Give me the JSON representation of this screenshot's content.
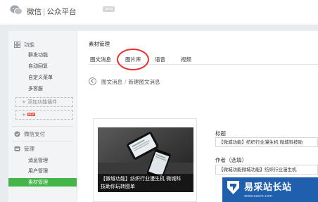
{
  "header": {
    "brand_left": "微信",
    "brand_sep": "|",
    "brand_right": "公众平台",
    "badge": "beta"
  },
  "sidebar": {
    "groups": [
      {
        "label": "功能",
        "icon": "function-icon"
      },
      {
        "label": "微信支付",
        "icon": "wechat-pay-icon"
      },
      {
        "label": "管理",
        "icon": "manage-icon"
      }
    ],
    "function_items": [
      "群发功能",
      "自动回复",
      "自定义菜单",
      "多客服"
    ],
    "add_plugin_label": "+ 添加功能插件",
    "add_plugin2_label": "+",
    "add_plugin2_badge": "NEW",
    "manage_items": [
      "消息管理",
      "用户管理",
      "素材管理"
    ]
  },
  "main": {
    "title": "素材管理",
    "tabs": [
      "图文消息",
      "图片库",
      "语音",
      "视频"
    ],
    "breadcrumb": {
      "parent": "图文消息",
      "separator": "/",
      "current": "新建图文消息"
    },
    "preview": {
      "caption_line1": "【微城功能】纺织行业漫生机 微城科",
      "caption_line2": "技助你玩转图单"
    },
    "form": {
      "title_label": "标题",
      "title_value": "【微城功能】纺织行业漫生机 微城科技助",
      "author_label": "作者（选填）",
      "author_value": "【微城功能微城功能】纺织行业漫生机"
    }
  },
  "watermark": {
    "name": "易采站长站",
    "url": "www.easck.com"
  },
  "colors": {
    "accent_green": "#44b549",
    "highlight_circle": "#e3342f",
    "watermark_bg": "#1f5fae"
  }
}
